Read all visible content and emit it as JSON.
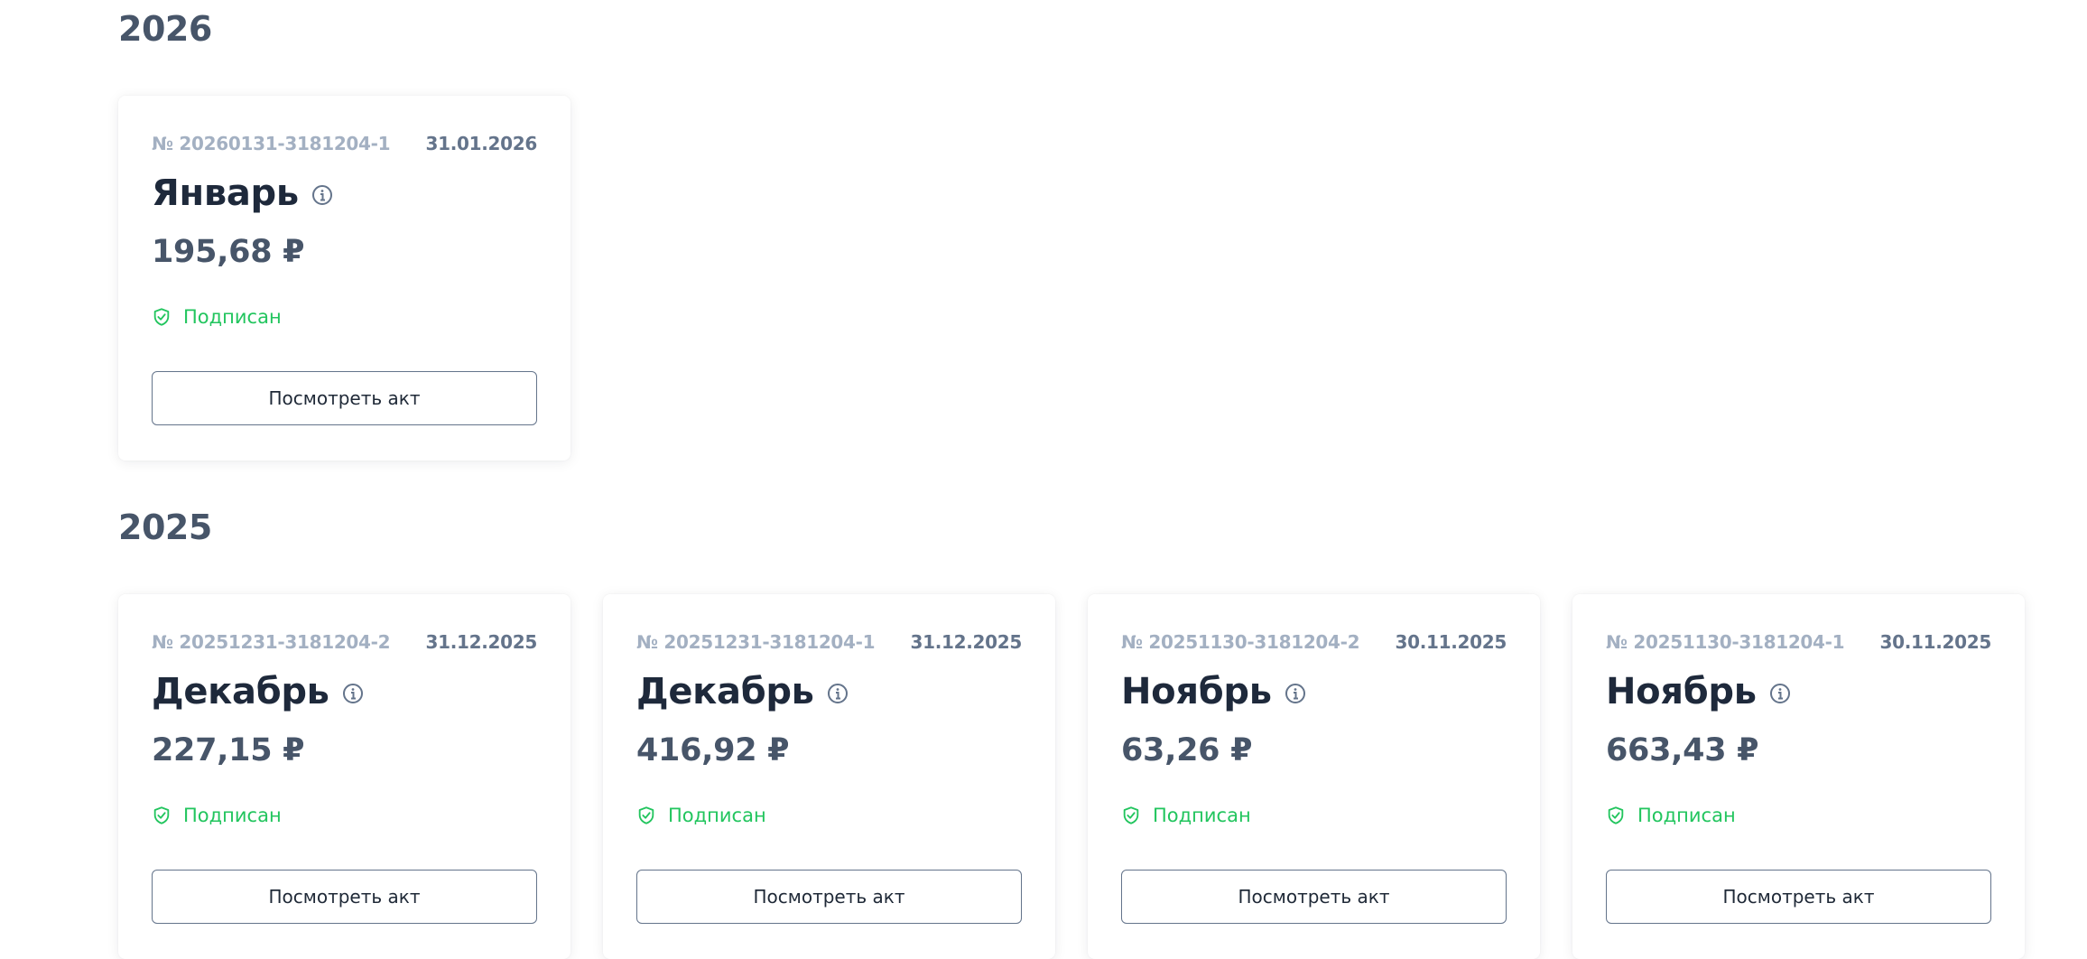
{
  "sections": [
    {
      "year": "2026",
      "cards": [
        {
          "number": "№ 20260131-3181204-1",
          "date": "31.01.2026",
          "month": "Январь",
          "amount": "195,68 ₽",
          "status": "Подписан",
          "button_label": "Посмотреть акт"
        }
      ]
    },
    {
      "year": "2025",
      "cards": [
        {
          "number": "№ 20251231-3181204-2",
          "date": "31.12.2025",
          "month": "Декабрь",
          "amount": "227,15 ₽",
          "status": "Подписан",
          "button_label": "Посмотреть акт"
        },
        {
          "number": "№ 20251231-3181204-1",
          "date": "31.12.2025",
          "month": "Декабрь",
          "amount": "416,92 ₽",
          "status": "Подписан",
          "button_label": "Посмотреть акт"
        },
        {
          "number": "№ 20251130-3181204-2",
          "date": "30.11.2025",
          "month": "Ноябрь",
          "amount": "63,26 ₽",
          "status": "Подписан",
          "button_label": "Посмотреть акт"
        },
        {
          "number": "№ 20251130-3181204-1",
          "date": "30.11.2025",
          "month": "Ноябрь",
          "amount": "663,43 ₽",
          "status": "Подписан",
          "button_label": "Посмотреть акт"
        }
      ]
    }
  ],
  "icons": {
    "info": "info-icon",
    "status": "shield-check-icon"
  },
  "colors": {
    "status_green": "#22c55e",
    "heading": "#475569",
    "title": "#1e293b",
    "number_muted": "#a3b0c2"
  }
}
